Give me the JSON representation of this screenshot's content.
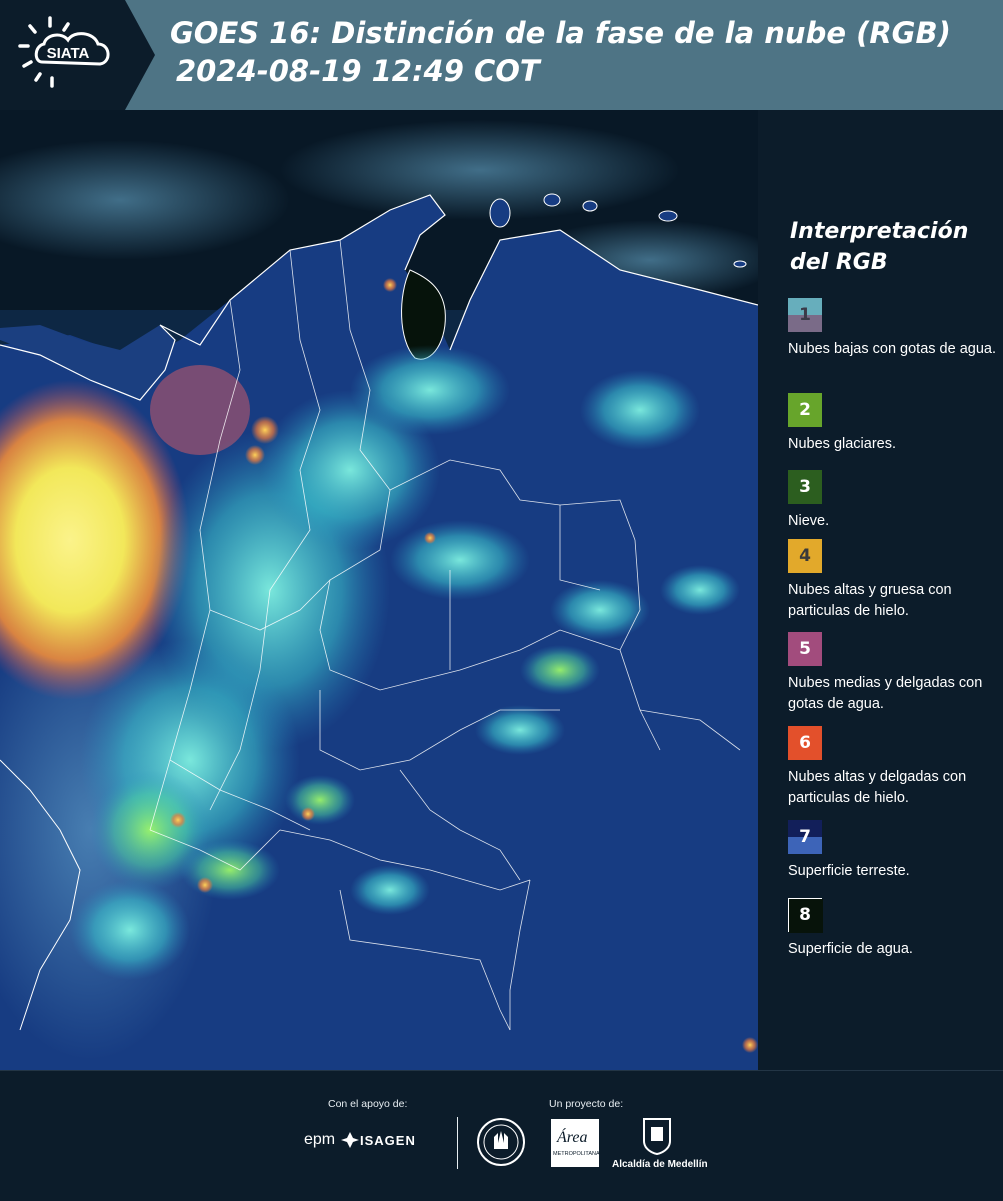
{
  "header": {
    "logo_text": "SIATA",
    "title_line1": "GOES 16: Distinción de la fase de la nube (RGB)",
    "title_line2": "2024-08-19 12:49 COT"
  },
  "legend": {
    "title": "Interpretación del RGB",
    "items": [
      {
        "number": "1",
        "label": "Nubes bajas con gotas de agua.",
        "color_top": "#67aebc",
        "color_bottom": "#7a6b88",
        "number_color": "#3a3a48"
      },
      {
        "number": "2",
        "label": "Nubes glaciares.",
        "color_top": "#67a52b",
        "color_bottom": "#67a52b",
        "number_color": "#ffffff"
      },
      {
        "number": "3",
        "label": "Nieve.",
        "color_top": "#2c5e1f",
        "color_bottom": "#2c5e1f",
        "number_color": "#ffffff"
      },
      {
        "number": "4",
        "label": "Nubes altas y gruesa con particulas de hielo.",
        "color_top": "#e2a92b",
        "color_bottom": "#e2a92b",
        "number_color": "#3a3a3a"
      },
      {
        "number": "5",
        "label": "Nubes medias y delgadas con gotas de agua.",
        "color_top": "#a24c7d",
        "color_bottom": "#a24c7d",
        "number_color": "#ffffff"
      },
      {
        "number": "6",
        "label": "Nubes altas y delgadas con particulas de hielo.",
        "color_top": "#e3502b",
        "color_bottom": "#e3502b",
        "number_color": "#ffffff"
      },
      {
        "number": "7",
        "label": "Superficie terreste.",
        "color_top": "#121f5a",
        "color_bottom": "#3d64b8",
        "number_color": "#ffffff"
      },
      {
        "number": "8",
        "label": "Superficie de agua.",
        "color_top": "#07130a",
        "color_bottom": "#07130a",
        "number_color": "#ffffff"
      }
    ]
  },
  "footer": {
    "support_caption": "Con el apoyo de:",
    "project_caption": "Un proyecto de:",
    "sponsors": [
      "epm",
      "ISAGEN"
    ],
    "project_logos": [
      "Área Metropolitana Valle de Aburrá",
      "Alcaldía de Medellín"
    ],
    "alcaldia_text": "Alcaldía de Medellín",
    "area_text": "Área",
    "area_subtext": "METROPOLITANA"
  },
  "map": {
    "colors": {
      "ocean": "#0d2744",
      "land": "#173c82",
      "water_body": "#06130b",
      "cloud_cyan": "#4fd6d8",
      "cloud_yellow": "#f2e85a",
      "cloud_orange": "#ee8b3a",
      "border": "#ffffff"
    }
  }
}
